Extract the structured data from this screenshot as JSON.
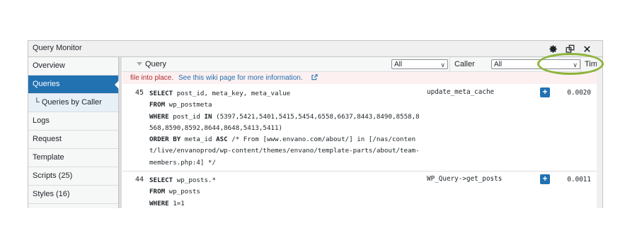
{
  "window": {
    "title": "Query Monitor"
  },
  "toolbar_icons": [
    "gear-icon",
    "popout-icon",
    "close-icon"
  ],
  "sidebar": {
    "items": [
      {
        "label": "Overview",
        "active": false,
        "sub": false
      },
      {
        "label": "Queries",
        "active": true,
        "sub": false
      },
      {
        "label": "└ Queries by Caller",
        "active": false,
        "sub": true
      },
      {
        "label": "Logs",
        "active": false,
        "sub": false
      },
      {
        "label": "Request",
        "active": false,
        "sub": false
      },
      {
        "label": "Template",
        "active": false,
        "sub": false
      },
      {
        "label": "Scripts (25)",
        "active": false,
        "sub": false
      },
      {
        "label": "Styles (16)",
        "active": false,
        "sub": false
      }
    ]
  },
  "table": {
    "headers": {
      "query": "Query",
      "caller": "Caller",
      "time": "Time"
    },
    "filters": {
      "query_filter": "All",
      "caller_filter": "All"
    },
    "time_sort_indicator": "▼",
    "error": {
      "text": "file into place.",
      "link": "See this wiki page for more information."
    },
    "rows": [
      {
        "num": "45",
        "sql_lines": [
          [
            "SELECT",
            " post_id, meta_key, meta_value"
          ],
          [
            "FROM",
            " wp_postmeta"
          ],
          [
            "WHERE",
            " post_id ",
            "IN",
            " (5397,5421,5401,5415,5454,6558,6637,8443,8490,8558,8"
          ],
          [
            "",
            "568,8590,8592,8644,8648,5413,5411)"
          ],
          [
            "ORDER BY",
            " meta_id ",
            "ASC",
            " /* From [www.envano.com/about/] in [/nas/conten"
          ],
          [
            "",
            "t/live/envanoprod/wp-content/themes/envano/template-parts/about/team-"
          ],
          [
            "",
            "members.php:4] */"
          ]
        ],
        "caller": "update_meta_cache",
        "time": "0.0020"
      },
      {
        "num": "44",
        "sql_lines": [
          [
            "SELECT",
            " wp_posts.*"
          ],
          [
            "FROM",
            " wp_posts"
          ],
          [
            "WHERE",
            " 1=1"
          ]
        ],
        "caller": "WP_Query->get_posts",
        "time": "0.0011"
      }
    ]
  },
  "colors": {
    "accent": "#2271b1",
    "highlight_ring": "#8cb43a",
    "error_text": "#b32d2e"
  }
}
